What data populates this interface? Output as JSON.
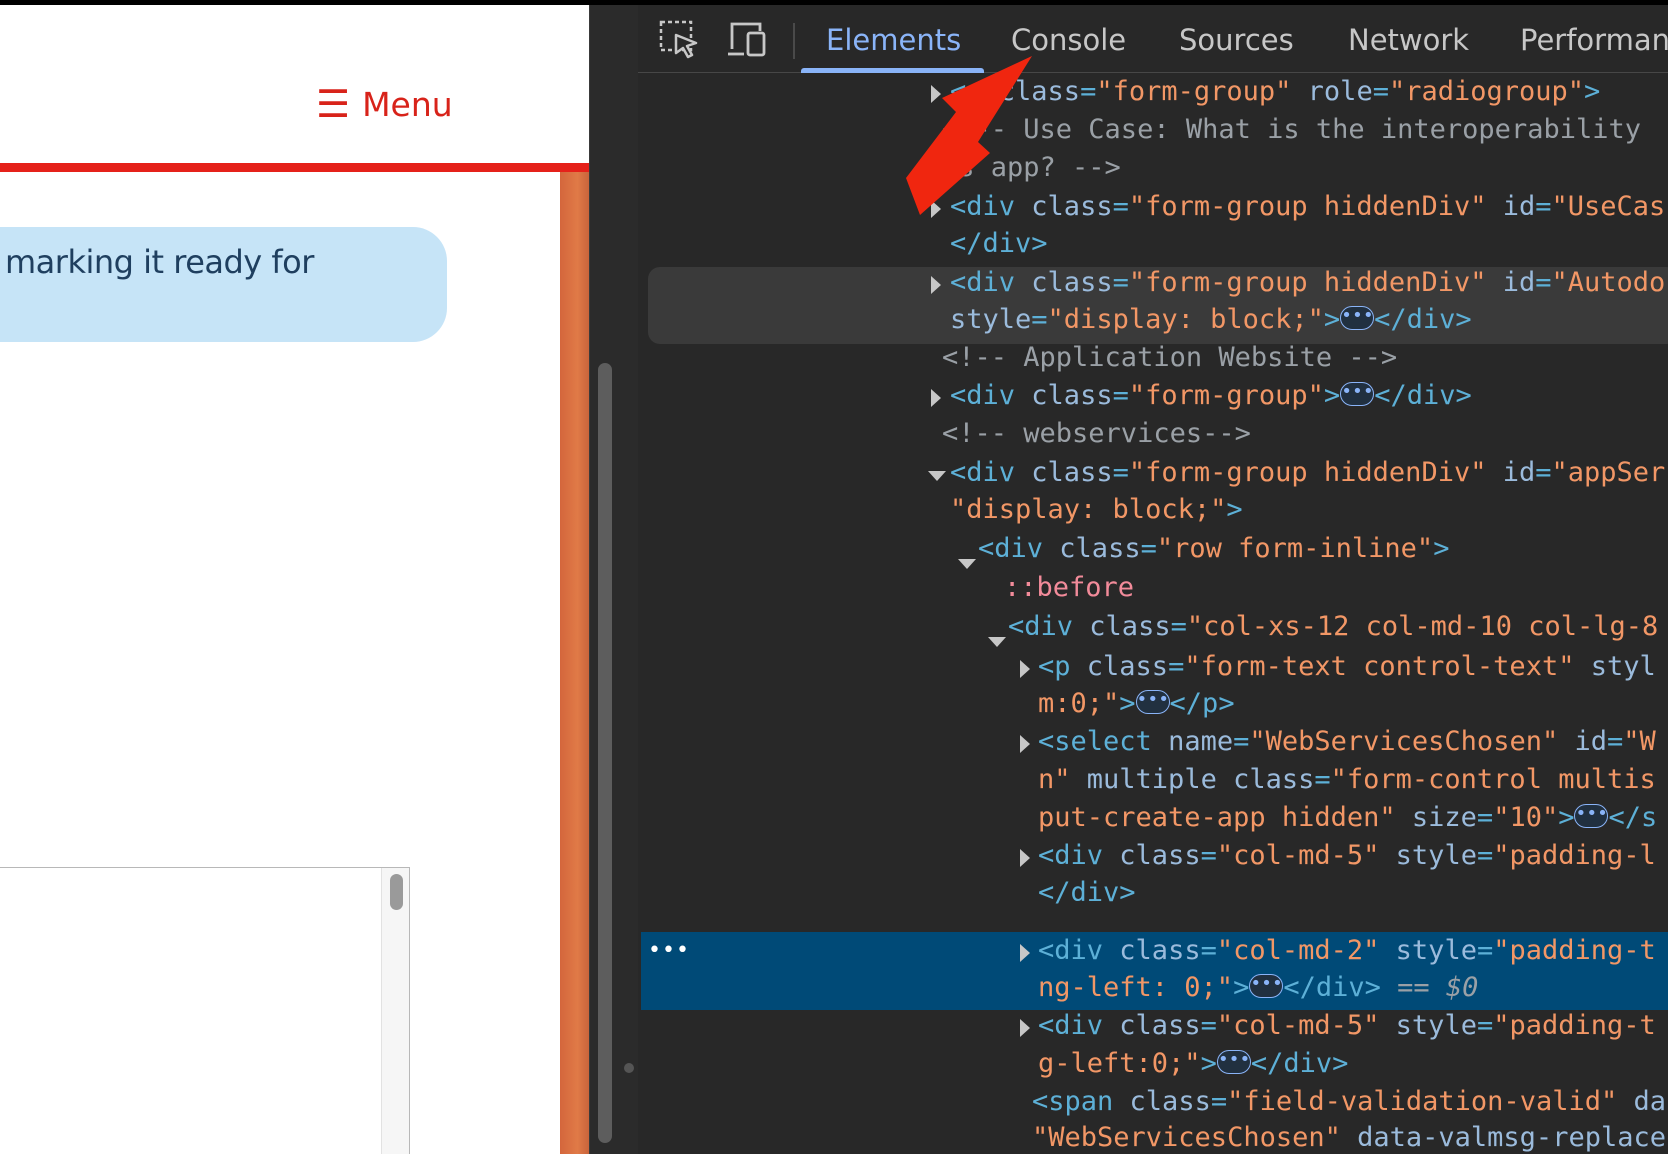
{
  "page": {
    "menu": {
      "glyph": "☰",
      "label": "Menu"
    },
    "notice_text": "marking it ready for",
    "colors": {
      "accent": "#e5211a",
      "notice_bg": "#c6e4f7",
      "side_edge": "#d4663c"
    }
  },
  "devtools": {
    "tools": {
      "inspect": "inspect-element-icon",
      "device": "device-toggle-icon"
    },
    "tabs": [
      {
        "label": "Elements"
      },
      {
        "label": "Console"
      },
      {
        "label": "Sources"
      },
      {
        "label": "Network"
      },
      {
        "label": "Performan"
      }
    ],
    "active_tab": "Elements",
    "tree": {
      "l1": {
        "pre": "<",
        "attr": "class",
        "val": "\"form-group\"",
        "attr2": "role",
        "val2": "\"radiogroup\"",
        "post": ">"
      },
      "l2": "<!-- Use Case: What is the interoperability",
      "l3": "is app? -->",
      "l4": {
        "tag": "<div",
        "attr": "class",
        "val": "\"form-group hiddenDiv\"",
        "attr2": "id",
        "val2": "\"UseCas"
      },
      "l5": "</div>",
      "l6": {
        "tag": "<div",
        "attr": "class",
        "val": "\"form-group hiddenDiv\"",
        "attr2": "id",
        "val2": "\"Autodo"
      },
      "l7": {
        "attr": "style",
        "val": "\"display: block;\"",
        "close": "</div>"
      },
      "l8": "<!-- Application Website -->",
      "l9": {
        "tag": "<div",
        "attr": "class",
        "val": "\"form-group\"",
        "close": "</div>"
      },
      "l10": "<!-- webservices-->",
      "l11": {
        "tag": "<div",
        "attr": "class",
        "val": "\"form-group hiddenDiv\"",
        "attr2": "id",
        "val2": "\"appSer"
      },
      "l12": {
        "val": "\"display: block;\""
      },
      "l13": {
        "tag": "<div",
        "attr": "class",
        "val": "\"row form-inline\""
      },
      "l14": "::before",
      "l15": {
        "tag": "<div",
        "attr": "class",
        "val": "\"col-xs-12 col-md-10 col-lg-8"
      },
      "l16": {
        "tag": "<p",
        "attr": "class",
        "val": "\"form-text control-text\"",
        "attr2": "styl"
      },
      "l17": {
        "val": "m:0;\"",
        "close": "</p>"
      },
      "l18": {
        "tag": "<select",
        "attr": "name",
        "val": "\"WebServicesChosen\"",
        "attr2": "id",
        "val2": "\"W"
      },
      "l19": {
        "val": "n\"",
        "attr": "multiple class",
        "val2": "\"form-control multis"
      },
      "l20": {
        "val": "put-create-app hidden\"",
        "attr": "size",
        "val2": "\"10\"",
        "close": "</s"
      },
      "l21": {
        "tag": "<div",
        "attr": "class",
        "val": "\"col-md-5\"",
        "attr2": "style",
        "val2": "\"padding-l"
      },
      "l22": "</div>",
      "l23": {
        "tag": "<div",
        "attr": "class",
        "val": "\"col-md-2\"",
        "attr2": "style",
        "val2": "\"padding-t"
      },
      "l24": {
        "val": "ng-left: 0;\"",
        "close": "</div>",
        "eq": "== $0"
      },
      "l25": {
        "tag": "<div",
        "attr": "class",
        "val": "\"col-md-5\"",
        "attr2": "style",
        "val2": "\"padding-t"
      },
      "l26": {
        "val": "g-left:0;\"",
        "close": "</div>"
      },
      "l27": {
        "tag": "<span",
        "attr": "class",
        "val": "\"field-validation-valid\"",
        "attr2": "da"
      },
      "l28": {
        "val": "\"WebServicesChosen\"",
        "attr": "data-valmsg-replace"
      }
    },
    "row_menu": "•••",
    "colors": {
      "tag": "#5db0d7",
      "attr": "#9bbbdc",
      "value": "#f29766",
      "comment": "#9aa0a6",
      "selected_row": "#004a77",
      "active_tab": "#8ab4f8"
    }
  },
  "annotation": {
    "type": "arrow",
    "color": "#f0260f",
    "target": "Console"
  }
}
